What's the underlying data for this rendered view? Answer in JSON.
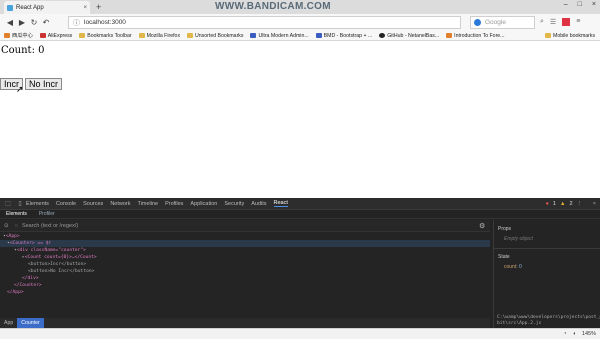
{
  "browser": {
    "tab_title": "React App",
    "tab_close": "×",
    "new_tab": "+",
    "watermark": "WWW.BANDICAM.COM",
    "window_buttons": [
      "–",
      "□",
      "×"
    ],
    "address": "localhost:3000",
    "search_placeholder": "Google",
    "nav_icons": [
      "back-icon",
      "forward-icon",
      "reload-icon",
      "undo-icon"
    ],
    "bookmarks": [
      {
        "label": "西瓜中心",
        "color": "orange"
      },
      {
        "label": "AliExpress",
        "color": "red"
      },
      {
        "label": "Bookmarks Toolbar",
        "color": "yellow"
      },
      {
        "label": "Mozilla Firefox",
        "color": "yellow"
      },
      {
        "label": "Unsorted Bookmarks",
        "color": "yellow"
      },
      {
        "label": "Ultra Modern Admin...",
        "color": "blue"
      },
      {
        "label": "BMD - Bootstrap + ...",
        "color": "blue"
      },
      {
        "label": "GitHub - NetanelBas...",
        "color": "dark"
      },
      {
        "label": "Introduction To Fore...",
        "color": "orange"
      }
    ],
    "mobile_bookmarks": "Mobile bookmarks"
  },
  "app": {
    "count_text": "Count: 0",
    "incr_label": "Incr",
    "no_incr_label": "No Incr"
  },
  "devtools": {
    "tabs": [
      "Elements",
      "Console",
      "Sources",
      "Network",
      "Timeline",
      "Profiles",
      "Application",
      "Security",
      "Audits",
      "React"
    ],
    "active_tab": "React",
    "errors": "1",
    "warnings": "2",
    "react_subtabs": [
      "Elements",
      "Profiler"
    ],
    "search_placeholder": "Search (text or /regex/)",
    "tree": [
      "<App>",
      "<Counter> == $r",
      "<div className=\"counter\">",
      "<Count count={0}>…</Count>",
      "<button>Incr</button>",
      "<button>No Incr</button>",
      "</div>",
      "</Counter>",
      "</App>"
    ],
    "props_heading": "Props",
    "props_empty": "Empty object",
    "state_heading": "State",
    "state_key": "count",
    "state_value": "0",
    "file_path": "C:\\wamp\\www\\developers\\projects\\post_projs\\react-bit\\src\\App.2.js",
    "breadcrumbs": [
      "App",
      "Counter"
    ]
  },
  "statusbar": {
    "zoom": "145%"
  }
}
